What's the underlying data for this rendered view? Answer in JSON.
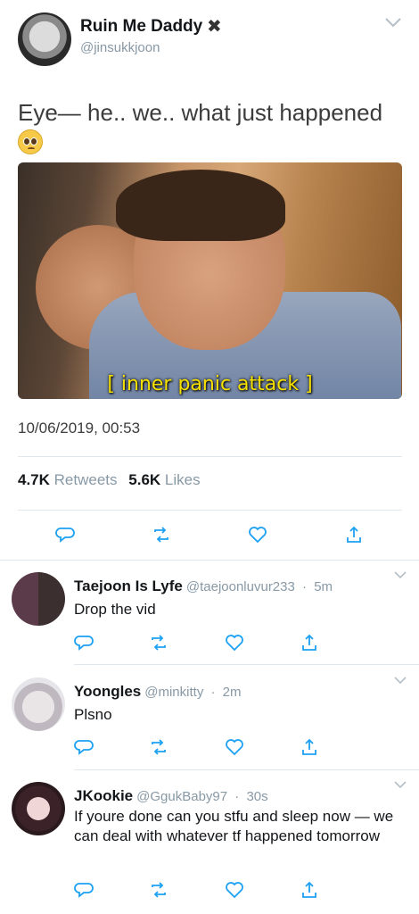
{
  "tweet": {
    "author_name": "Ruin Me Daddy",
    "author_badge": "✖",
    "author_handle": "@jinsukkjoon",
    "text": "Eye— he.. we.. what just happened",
    "emoji": "pleading-face",
    "media_caption": "[ inner panic attack ]",
    "timestamp": "10/06/2019, 00:53",
    "retweets_count": "4.7K",
    "retweets_label": "Retweets",
    "likes_count": "5.6K",
    "likes_label": "Likes"
  },
  "replies": [
    {
      "name": "Taejoon Is Lyfe",
      "handle": "@taejoonluvur233",
      "time": "5m",
      "text": "Drop the vid"
    },
    {
      "name": "Yoongles",
      "handle": "@minkitty",
      "time": "2m",
      "text": "Plsno"
    },
    {
      "name": "JKookie",
      "handle": "@GgukBaby97",
      "time": "30s",
      "text": "If youre done can you stfu and sleep now — we can deal with whatever tf happened tomorrow"
    }
  ],
  "icons": [
    "reply-icon",
    "retweet-icon",
    "like-icon",
    "share-icon",
    "chevron-down-icon"
  ],
  "colors": {
    "secondary_text": "#8899a6",
    "divider": "#e1e8ed",
    "caption": "#f5e000"
  }
}
